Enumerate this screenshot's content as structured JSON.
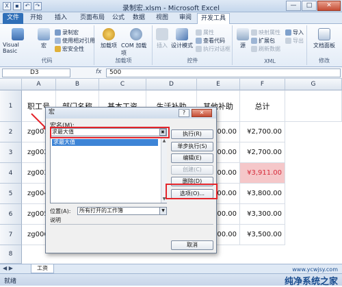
{
  "window": {
    "title": "录制宏.xlsm - Microsoft Excel",
    "buttons": [
      "—",
      "□",
      "✕"
    ]
  },
  "tabs": [
    "文件",
    "开始",
    "插入",
    "页面布局",
    "公式",
    "数据",
    "视图",
    "审阅",
    "开发工具"
  ],
  "ribbon": {
    "code_group": {
      "label": "代码",
      "visual_basic": "Visual Basic",
      "macros": "宏",
      "record_macro": "录制宏",
      "relative_refs": "使用相对引用",
      "macro_security": "宏安全性"
    },
    "addins_group": {
      "label": "加载项",
      "addins": "加载项",
      "com_addins": "COM 加载项"
    },
    "controls_group": {
      "label": "控件",
      "insert": "插入",
      "design_mode": "设计模式",
      "properties": "属性",
      "view_code": "查看代码",
      "run_dialog": "执行对话框"
    },
    "xml_group": {
      "label": "XML",
      "source": "源",
      "map_properties": "映射属性",
      "expansion_packs": "扩展包",
      "refresh_data": "刷新数据",
      "import": "导入",
      "export": "导出"
    },
    "modify_group": {
      "label": "修改",
      "doc_panel": "文档面板"
    }
  },
  "formula_bar": {
    "name_box": "D3",
    "fx": "fx",
    "value": "500"
  },
  "grid": {
    "columns": [
      "A",
      "B",
      "C",
      "D",
      "E",
      "F",
      "G"
    ],
    "rows": [
      "1",
      "2",
      "3",
      "4",
      "5",
      "6",
      "7",
      "8"
    ],
    "headers": [
      "职工号",
      "部门名称",
      "基本工资",
      "生活补助",
      "其他补助",
      "总计"
    ],
    "ids": [
      "zg001",
      "zg002",
      "zg003",
      "zg004",
      "zg005",
      "zg006"
    ],
    "other_allowance": [
      "200.00",
      "200.00",
      "200.00",
      "200.00",
      "200.00",
      "200.00"
    ],
    "totals": [
      "¥2,700.00",
      "¥2,700.00",
      "¥3,911.00",
      "¥3,800.00",
      "¥3,300.00",
      "¥3,500.00"
    ]
  },
  "sheet_tab": "工资",
  "status": "就绪",
  "watermark": {
    "brand": "纯净系统之家",
    "url": "www.ycwjsy.com"
  },
  "dialog": {
    "title": "宏",
    "help": "?",
    "close": "✕",
    "name_label": "宏名(M):",
    "name_value": "求最大值",
    "list_items": [
      "求最大值"
    ],
    "buttons": {
      "run": "执行(R)",
      "step_into": "单步执行(S)",
      "edit": "编辑(E)",
      "create": "创建(C)",
      "delete": "删除(D)",
      "options": "选项(O)...",
      "cancel": "取消"
    },
    "location_label": "位置(A):",
    "location_value": "所有打开的工作簿",
    "description_label": "说明"
  },
  "colors": {
    "accent": "#2f6fb8",
    "highlight_red": "#e4242a",
    "cell_highlight": "#f5c7c9"
  }
}
